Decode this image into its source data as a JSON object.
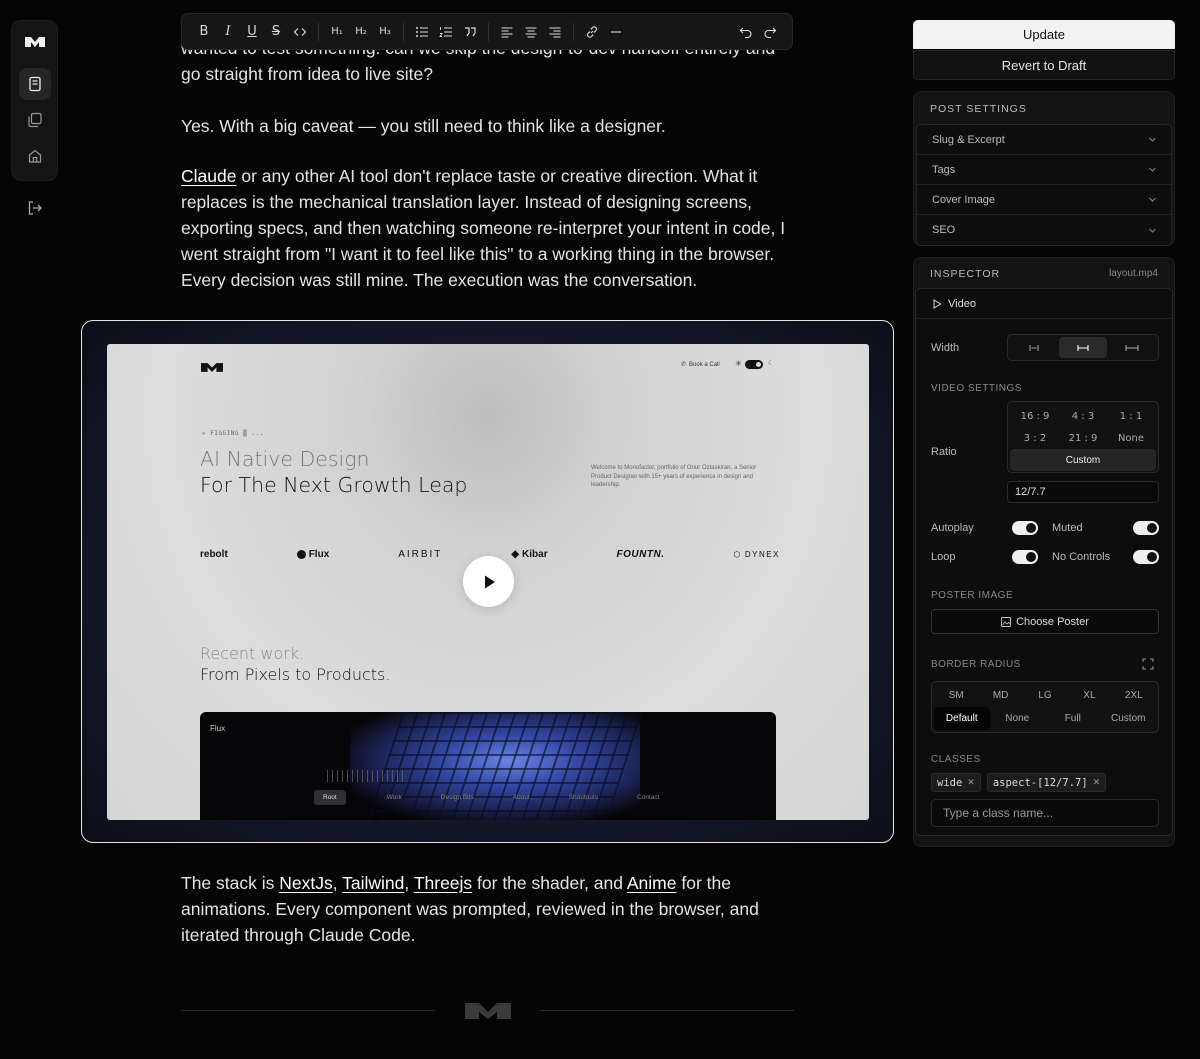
{
  "toolbar": {
    "bold": "B",
    "italic": "I",
    "underline": "U",
    "strike": "S",
    "h1": "H₁",
    "h2": "H₂",
    "h3": "H₃"
  },
  "content": {
    "p1_line1": "wanted to test something: can we skip the design-to-dev handoff entirely and",
    "p1_line2": "go straight from idea to live site?",
    "p2": "Yes. With a big caveat — you still need to think like a designer.",
    "p3_link": "Claude",
    "p3_text": " or any other AI tool don't replace taste or creative direction. What it replaces is the mechanical translation layer. Instead of designing screens, exporting specs, and then watching someone re-interpret your intent in code, I went straight from \"I want it to feel like this\" to a working thing in the browser. Every decision was still mine. The execution was the conversation.",
    "p4": {
      "t1": "The stack is ",
      "l1": "NextJs",
      "t2": ", ",
      "l2": "Tailwind",
      "t3": ", ",
      "l3": "Threejs",
      "t4": " for the shader, and ",
      "l4": "Anime",
      "t5": " for the animations. Every component was prompted, reviewed in the browser, and iterated through Claude Code."
    }
  },
  "video_preview": {
    "book_call": "Book a Call",
    "tag": "✳ FIGGING ▒ ...",
    "headline_1": "AI Native Design",
    "headline_2": "For The Next Growth Leap",
    "welcome": "Welcome to Monofactor, portfolio of Onur Oztaskiran, a Senior Product Designer with 15+ years of experience in design and leadership.",
    "brands": [
      "rebolt",
      "Flux",
      "AIRBIT",
      "Kibar",
      "FOUNTN.",
      "DYNEX"
    ],
    "recent_1": "Recent work.",
    "recent_2": "From Pixels to Products.",
    "card_label": "Flux",
    "nav": [
      "Root",
      "Work",
      "Design Bits",
      "About",
      "Shoutouts",
      "Contact"
    ]
  },
  "actions": {
    "update": "Update",
    "revert": "Revert to Draft"
  },
  "post_settings": {
    "title": "POST SETTINGS",
    "items": [
      "Slug & Excerpt",
      "Tags",
      "Cover Image",
      "SEO"
    ]
  },
  "inspector": {
    "title": "INSPECTOR",
    "file": "layout.mp4",
    "block": "Video",
    "width_label": "Width",
    "video_settings": "VIDEO SETTINGS",
    "ratio_label": "Ratio",
    "ratios": [
      "16 : 9",
      "4 : 3",
      "1 : 1",
      "3 : 2",
      "21 : 9",
      "None"
    ],
    "ratio_custom": "Custom",
    "ratio_value": "12/7.7",
    "autoplay": "Autoplay",
    "muted": "Muted",
    "loop": "Loop",
    "no_controls": "No Controls",
    "toggles": {
      "autoplay": true,
      "muted": true,
      "loop": true,
      "no_controls": true
    },
    "poster_label": "POSTER IMAGE",
    "poster_button": "Choose Poster",
    "radius_label": "BORDER RADIUS",
    "radius_row1": [
      "SM",
      "MD",
      "LG",
      "XL",
      "2XL"
    ],
    "radius_row2": [
      "Default",
      "None",
      "Full",
      "Custom"
    ],
    "radius_selected": "Default",
    "classes_label": "CLASSES",
    "classes": [
      "wide",
      "aspect-[12/7.7]"
    ],
    "class_placeholder": "Type a class name..."
  },
  "colors": {
    "background": "#050505",
    "panel": "#131313",
    "accent": "#f2f2f2"
  }
}
